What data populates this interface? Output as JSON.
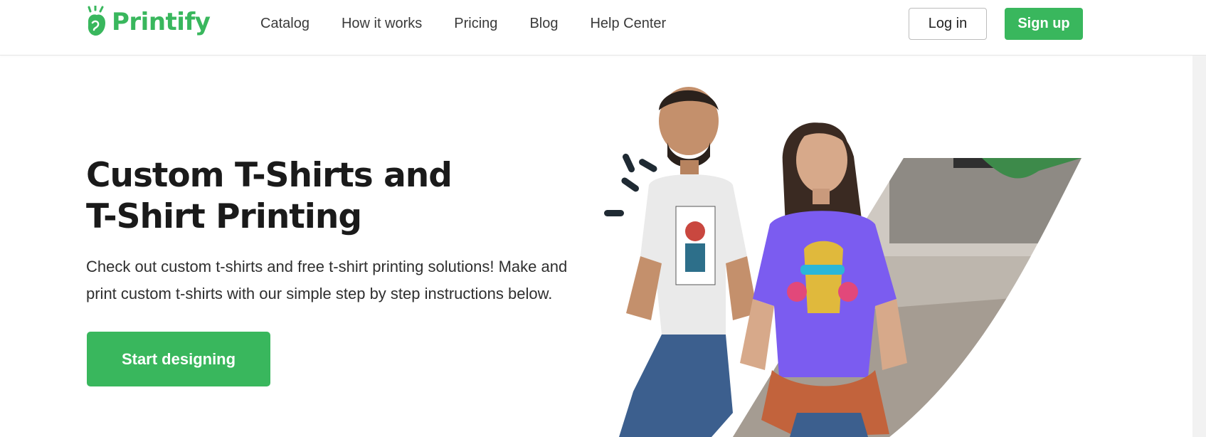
{
  "header": {
    "logo_text": "Printify",
    "nav": [
      "Catalog",
      "How it works",
      "Pricing",
      "Blog",
      "Help Center"
    ],
    "login_label": "Log in",
    "signup_label": "Sign up"
  },
  "hero": {
    "title_line1": "Custom T-Shirts and",
    "title_line2": "T-Shirt Printing",
    "description": "Check out custom t-shirts and free t-shirt printing solutions! Make and print custom t-shirts with our simple step by step instructions below.",
    "cta_label": "Start designing",
    "image_icon": "hero-photo-models-icon"
  },
  "colors": {
    "brand_green": "#39b75d",
    "text_dark": "#1a1a1a",
    "shirt_purple": "#7b5cf0"
  }
}
